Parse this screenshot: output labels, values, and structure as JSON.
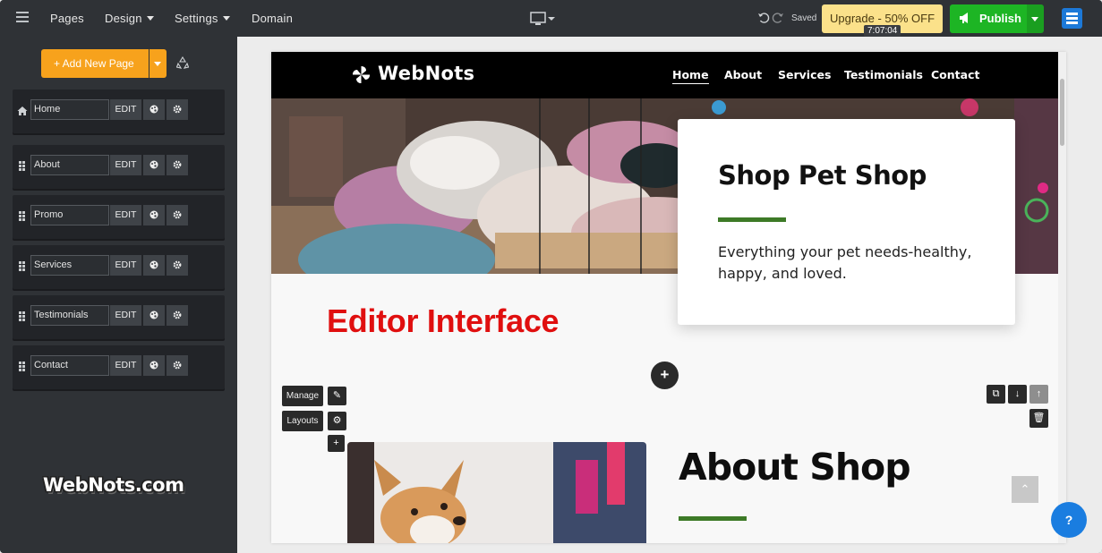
{
  "topbar": {
    "nav": [
      "Pages",
      "Design",
      "Settings",
      "Domain"
    ],
    "saved_label": "Saved",
    "upgrade_label": "Upgrade  - 50% OFF",
    "timer": "7:07:04",
    "publish_label": "Publish",
    "icons": [
      "menu-icon",
      "desktop-icon",
      "undo-icon",
      "redo-icon",
      "megaphone-icon",
      "brand-icon"
    ]
  },
  "sidebar": {
    "add_page_label": "+ Add New Page",
    "pages": [
      {
        "name": "Home",
        "icon": "home-icon"
      },
      {
        "name": "About",
        "icon": "drag-handle-icon"
      },
      {
        "name": "Promo",
        "icon": "drag-handle-icon"
      },
      {
        "name": "Services",
        "icon": "drag-handle-icon"
      },
      {
        "name": "Testimonials",
        "icon": "drag-handle-icon"
      },
      {
        "name": "Contact",
        "icon": "drag-handle-icon"
      }
    ],
    "edit_label": "EDIT"
  },
  "watermark": "WebNots.com",
  "site": {
    "logo_text": "WebNots",
    "nav": [
      "Home",
      "About",
      "Services",
      "Testimonials",
      "Contact"
    ],
    "active_nav": "Home",
    "hero_title": "Shop Pet Shop",
    "hero_text": "Everything your pet needs-healthy, happy, and loved.",
    "about_title": "About Shop",
    "accent_color": "#3d7a27"
  },
  "editor": {
    "annotation": "Editor Interface",
    "manage_label": "Manage",
    "layouts_label": "Layouts",
    "help_label": "?"
  },
  "colors": {
    "upgrade": "#fbe18a",
    "publish": "#1db524",
    "add_page": "#f7a21c",
    "annotation": "#e00f0f"
  }
}
